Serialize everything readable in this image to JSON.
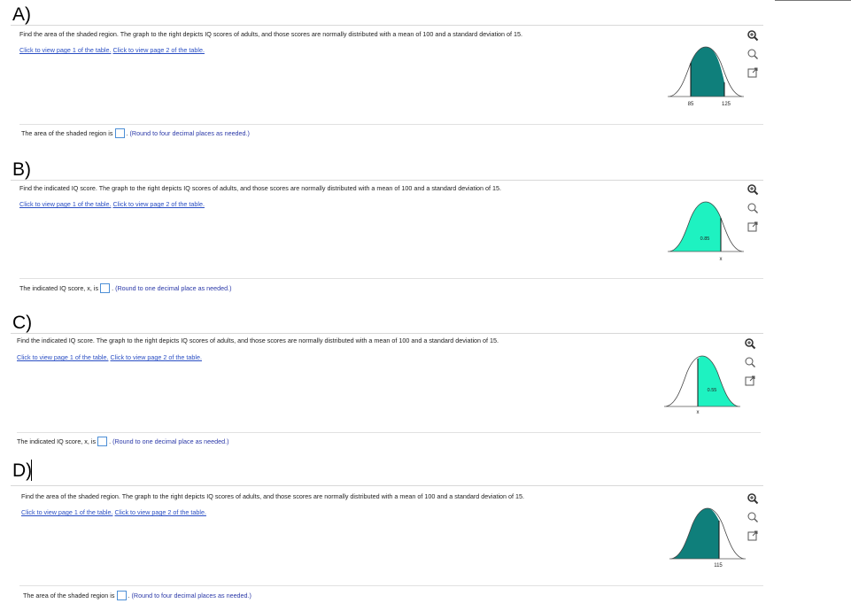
{
  "sections": [
    {
      "label": "A)",
      "question": "Find the area of the shaded region. The graph to the right depicts IQ scores of adults, and those scores are normally distributed with a mean of 100 and a standard deviation of 15.",
      "link1": "Click to view page 1 of the table.",
      "link2": "Click to view page 2 of the table.",
      "answer_prefix": "The area of the shaded region is",
      "answer_hint": "(Round to four decimal places as needed.)",
      "graph_labels": [
        "85",
        "125"
      ],
      "shade_color": "#0f7f7b"
    },
    {
      "label": "B)",
      "question": "Find the indicated IQ score. The graph to the right depicts IQ scores of adults, and those scores are normally distributed with a mean of 100 and a standard deviation of 15.",
      "link1": "Click to view page 1 of the table.",
      "link2": "Click to view page 2 of the table.",
      "answer_prefix": "The indicated IQ score, x, is",
      "answer_hint": "(Round to one decimal place as needed.)",
      "graph_labels": [
        "0.85",
        "x"
      ],
      "shade_color": "#1ef2c1"
    },
    {
      "label": "C)",
      "question": "Find the indicated IQ score. The graph to the right depicts IQ scores of adults, and those scores are normally distributed with a mean of 100 and a standard deviation of 15.",
      "link1": "Click to view page 1 of the table.",
      "link2": "Click to view page 2 of the table.",
      "answer_prefix": "The indicated IQ score, x, is",
      "answer_hint": "(Round to one decimal place as needed.)",
      "graph_labels": [
        "0.55",
        "x"
      ],
      "shade_color": "#1ef2c1"
    },
    {
      "label": "D)",
      "question": "Find the area of the shaded region. The graph to the right depicts IQ scores of adults, and those scores are normally distributed with a mean of 100 and a standard deviation of 15.",
      "link1": "Click to view page 1 of the table.",
      "link2": "Click to view page 2 of the table.",
      "answer_prefix": "The area of the shaded region is",
      "answer_hint": "(Round to four decimal places as needed.)",
      "graph_labels": [
        "115"
      ],
      "shade_color": "#0f7f7b"
    }
  ],
  "icons": [
    "zoom-in-icon",
    "zoom-out-icon",
    "popout-icon"
  ]
}
